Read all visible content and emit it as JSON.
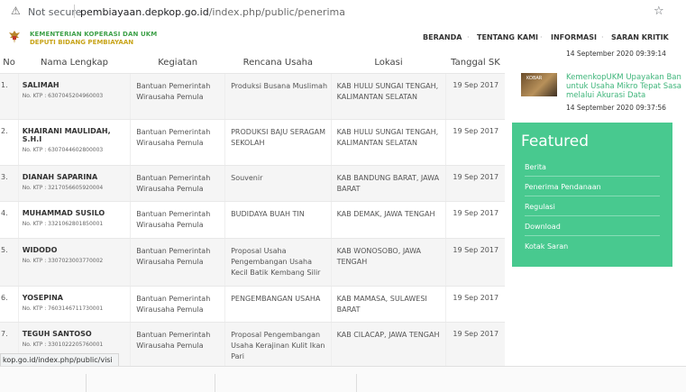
{
  "browser": {
    "security": "Not secure",
    "url_host": "pembiayaan.depkop.go.id",
    "url_path": "/index.php/public/penerima"
  },
  "site": {
    "org_line1": "KEMENTERIAN KOPERASI DAN UKM",
    "org_line2": "DEPUTI BIDANG PEMBIAYAAN",
    "nav": [
      "BERANDA",
      "TENTANG KAMI",
      "INFORMASI",
      "SARAN KRITIK"
    ]
  },
  "table": {
    "headers": [
      "No",
      "Nama Lengkap",
      "Kegiatan",
      "Rencana Usaha",
      "Lokasi",
      "Tanggal SK"
    ],
    "rows": [
      {
        "no": "1.",
        "name": "SALIMAH",
        "ktp": "No. KTP : 6307045204960003",
        "kegiatan": "Bantuan Pemerintah Wirausaha Pemula",
        "rencana": "Produksi Busana Muslimah",
        "lokasi": "KAB HULU SUNGAI TENGAH, KALIMANTAN SELATAN",
        "tanggal": "19 Sep 2017"
      },
      {
        "no": "2.",
        "name": "KHAIRANI MAULIDAH, S.H.I",
        "ktp": "No. KTP : 6307044602800003",
        "kegiatan": "Bantuan Pemerintah Wirausaha Pemula",
        "rencana": "PRODUKSI BAJU SERAGAM SEKOLAH",
        "lokasi": "KAB HULU SUNGAI TENGAH, KALIMANTAN SELATAN",
        "tanggal": "19 Sep 2017"
      },
      {
        "no": "3.",
        "name": "DIANAH SAPARINA",
        "ktp": "No. KTP : 3217056605920004",
        "kegiatan": "Bantuan Pemerintah Wirausaha Pemula",
        "rencana": "Souvenir",
        "lokasi": "KAB BANDUNG BARAT, JAWA BARAT",
        "tanggal": "19 Sep 2017"
      },
      {
        "no": "4.",
        "name": "MUHAMMAD SUSILO",
        "ktp": "No. KTP : 3321062801850001",
        "kegiatan": "Bantuan Pemerintah Wirausaha Pemula",
        "rencana": "BUDIDAYA BUAH TIN",
        "lokasi": "KAB DEMAK, JAWA TENGAH",
        "tanggal": "19 Sep 2017"
      },
      {
        "no": "5.",
        "name": "WIDODO",
        "ktp": "No. KTP : 3307023003770002",
        "kegiatan": "Bantuan Pemerintah Wirausaha Pemula",
        "rencana": "Proposal Usaha Pengembangan Usaha Kecil Batik Kembang Silir",
        "lokasi": "KAB WONOSOBO, JAWA TENGAH",
        "tanggal": "19 Sep 2017"
      },
      {
        "no": "6.",
        "name": "YOSEPINA",
        "ktp": "No. KTP : 7603146711730001",
        "kegiatan": "Bantuan Pemerintah Wirausaha Pemula",
        "rencana": "PENGEMBANGAN USAHA",
        "lokasi": "KAB MAMASA, SULAWESI BARAT",
        "tanggal": "19 Sep 2017"
      },
      {
        "no": "7.",
        "name": "TEGUH SANTOSO",
        "ktp": "No. KTP : 3301022205760001",
        "kegiatan": "Bantuan Pemerintah Wirausaha Pemula",
        "rencana": "Proposal Pengembangan Usaha Kerajinan Kulit Ikan Pari",
        "lokasi": "KAB CILACAP, JAWA TENGAH",
        "tanggal": "19 Sep 2017"
      }
    ]
  },
  "sidebar": {
    "news1_time": "14 September 2020 09:39:14",
    "news2_title": "KemenkopUKM Upayakan Ban untuk Usaha Mikro Tepat Sasa melalui Akurasi Data",
    "news2_time": "14 September 2020 09:37:56",
    "thumb_text": "KOBAR",
    "featured_title": "Featured",
    "featured_items": [
      "Berita",
      "Penerima Pendanaan",
      "Regulasi",
      "Download",
      "Kotak Saran"
    ]
  },
  "status_url": "kop.go.id/index.php/public/visi",
  "colors": {
    "featured_bg": "#48c98f",
    "news_link": "#3eb57a",
    "org_green": "#3fa14a",
    "org_gold": "#c8a419"
  }
}
